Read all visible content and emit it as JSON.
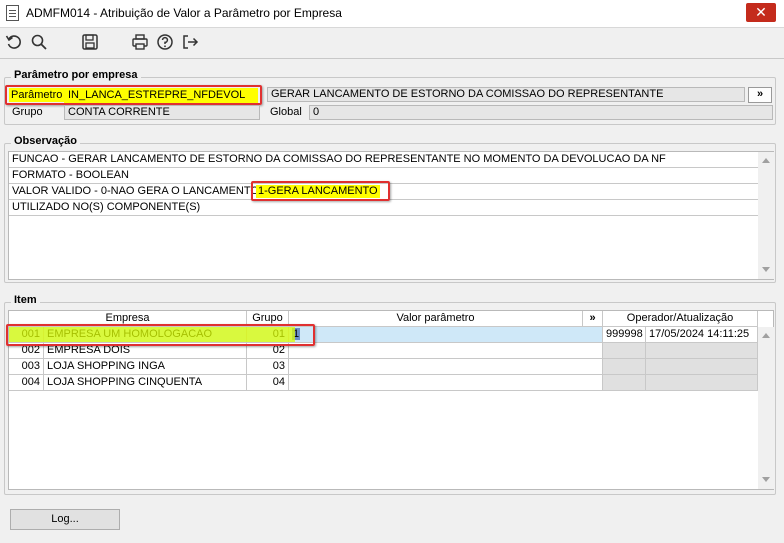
{
  "window": {
    "title": "ADMFM014 - Atribuição de Valor a Parâmetro por Empresa",
    "close_glyph": "✕"
  },
  "toolbar": {
    "icons": [
      "undo-icon",
      "search-icon",
      "save-icon",
      "print-icon",
      "help-icon",
      "exit-icon"
    ]
  },
  "parametro": {
    "legend": "Parâmetro por empresa",
    "parametro_label": "Parâmetro",
    "parametro_value": "IN_LANCA_ESTREPRE_NFDEVOL",
    "descricao_value": "GERAR LANCAMENTO DE ESTORNO DA COMISSAO DO REPRESENTANTE",
    "expand_label": "»",
    "grupo_label": "Grupo",
    "grupo_value": "CONTA CORRENTE",
    "global_label": "Global",
    "global_value": "0"
  },
  "observacao": {
    "legend": "Observação",
    "lines": [
      "FUNCAO - GERAR LANCAMENTO DE ESTORNO DA COMISSAO DO REPRESENTANTE NO MOMENTO DA DEVOLUCAO DA NF",
      "FORMATO - BOOLEAN",
      "VALOR VALIDO -  0-NAO GERA O LANCAMENTO / ",
      "UTILIZADO NO(S) COMPONENTE(S)"
    ],
    "highlight_text": "1-GERA LANCAMENTO"
  },
  "item": {
    "legend": "Item",
    "headers": {
      "empresa": "Empresa",
      "grupo": "Grupo",
      "valor": "Valor parâmetro",
      "expand": "»",
      "operador": "Operador/Atualização"
    },
    "rows": [
      {
        "codigo": "001",
        "empresa": "EMPRESA UM HOMOLOGACAO",
        "grupo": "01",
        "valor": "1",
        "operador": "999998",
        "atualizacao": "17/05/2024 14:11:25"
      },
      {
        "codigo": "002",
        "empresa": "EMPRESA DOIS",
        "grupo": "02",
        "valor": "",
        "operador": "",
        "atualizacao": ""
      },
      {
        "codigo": "003",
        "empresa": "LOJA SHOPPING INGA",
        "grupo": "03",
        "valor": "",
        "operador": "",
        "atualizacao": ""
      },
      {
        "codigo": "004",
        "empresa": "LOJA SHOPPING CINQUENTA",
        "grupo": "04",
        "valor": "",
        "operador": "",
        "atualizacao": ""
      }
    ]
  },
  "footer": {
    "log_button": "Log..."
  },
  "colors": {
    "highlight": "#ffff00",
    "annotation": "#e03030",
    "selection": "#cfe8f8",
    "close": "#c42b1c"
  }
}
